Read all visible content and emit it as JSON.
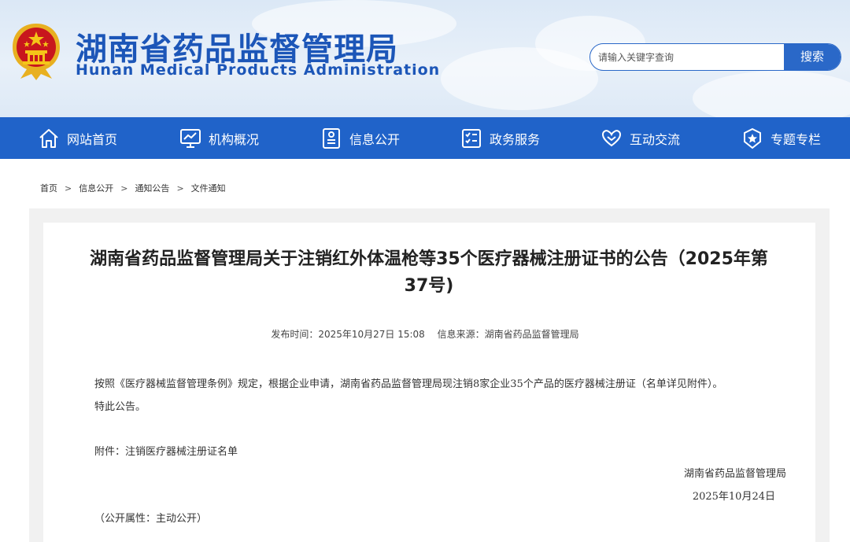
{
  "header": {
    "title": "湖南省药品监督管理局",
    "subtitle": "Hunan Medical Products Administration"
  },
  "search": {
    "placeholder": "请输入关键字查询",
    "button_label": "搜索"
  },
  "nav": {
    "items": [
      {
        "label": "网站首页",
        "icon": "home-icon"
      },
      {
        "label": "机构概况",
        "icon": "monitor-chart-icon"
      },
      {
        "label": "信息公开",
        "icon": "document-list-icon"
      },
      {
        "label": "政务服务",
        "icon": "checklist-icon"
      },
      {
        "label": "互动交流",
        "icon": "heart-hands-icon"
      },
      {
        "label": "专题专栏",
        "icon": "star-badge-icon"
      }
    ]
  },
  "breadcrumb": [
    "首页",
    "信息公开",
    "通知公告",
    "文件通知"
  ],
  "article": {
    "title_line1": "湖南省药品监督管理局关于注销红外体温枪等35个医疗器械注册证书的公告（2025年第",
    "title_line2": "37号)",
    "publish_time": "发布时间：2025年10月27日 15:08",
    "source": "信息来源：湖南省药品监督管理局",
    "paragraph1": "按照《医疗器械监督管理条例》规定，根据企业申请，湖南省药品监督管理局现注销8家企业35个产品的医疗器械注册证（名单详见附件）。",
    "paragraph2": "特此公告。",
    "attachment": "附件：注销医疗器械注册证名单",
    "signature": "湖南省药品监督管理局",
    "date": "2025年10月24日",
    "disclosure": "（公开属性：主动公开）"
  },
  "colors": {
    "brand_blue": "#2063c9",
    "title_blue": "#1c56b8",
    "emblem_red": "#c8161d",
    "emblem_gold": "#f5c518"
  }
}
